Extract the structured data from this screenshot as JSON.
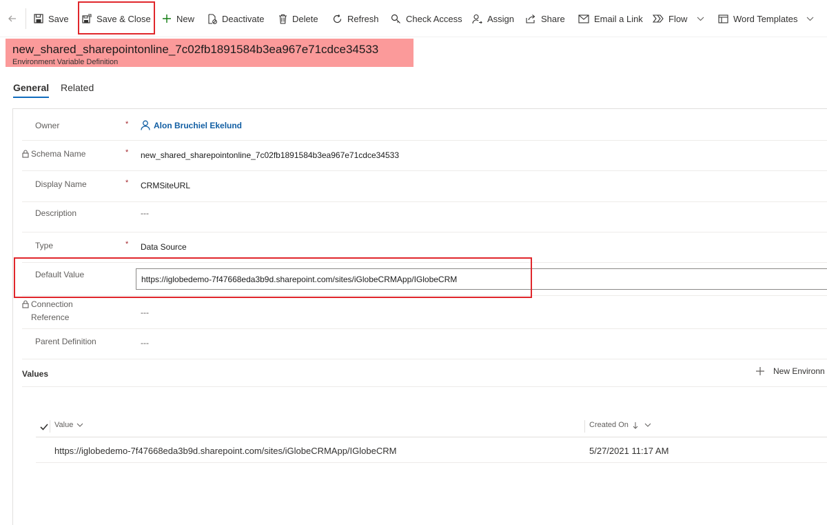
{
  "toolbar": {
    "save_label": "Save",
    "save_close_label": "Save & Close",
    "new_label": "New",
    "deactivate_label": "Deactivate",
    "delete_label": "Delete",
    "refresh_label": "Refresh",
    "check_access_label": "Check Access",
    "assign_label": "Assign",
    "share_label": "Share",
    "email_link_label": "Email a Link",
    "flow_label": "Flow",
    "word_templates_label": "Word Templates"
  },
  "header": {
    "title": "new_shared_sharepointonline_7c02fb1891584b3ea967e71cdce34533",
    "subtitle": "Environment Variable Definition"
  },
  "tabs": {
    "general": "General",
    "related": "Related"
  },
  "form": {
    "owner": {
      "label": "Owner",
      "value": "Alon Bruchiel Ekelund"
    },
    "schema_name": {
      "label": "Schema Name",
      "value": "new_shared_sharepointonline_7c02fb1891584b3ea967e71cdce34533"
    },
    "display_name": {
      "label": "Display Name",
      "value": "CRMSiteURL"
    },
    "description": {
      "label": "Description",
      "value": "---"
    },
    "type": {
      "label": "Type",
      "value": "Data Source"
    },
    "default_value": {
      "label": "Default Value",
      "value": "https://iglobedemo-7f47668eda3b9d.sharepoint.com/sites/iGlobeCRMApp/IGlobeCRM"
    },
    "connection_reference": {
      "label_line1": "Connection",
      "label_line2": "Reference",
      "value": "---"
    },
    "parent_definition": {
      "label": "Parent Definition",
      "value": "---"
    },
    "required_marker": "*"
  },
  "values_section": {
    "title": "Values",
    "new_button_label": "New Environn",
    "columns": {
      "value": "Value",
      "created_on": "Created On"
    },
    "rows": [
      {
        "value": "https://iglobedemo-7f47668eda3b9d.sharepoint.com/sites/iGlobeCRMApp/IGlobeCRM",
        "created_on": "5/27/2021 11:17 AM"
      }
    ]
  },
  "colors": {
    "accent": "#0f6cbd",
    "highlight_red": "#e0262b",
    "header_band": "#fb9a9a",
    "required": "#a4262c"
  }
}
